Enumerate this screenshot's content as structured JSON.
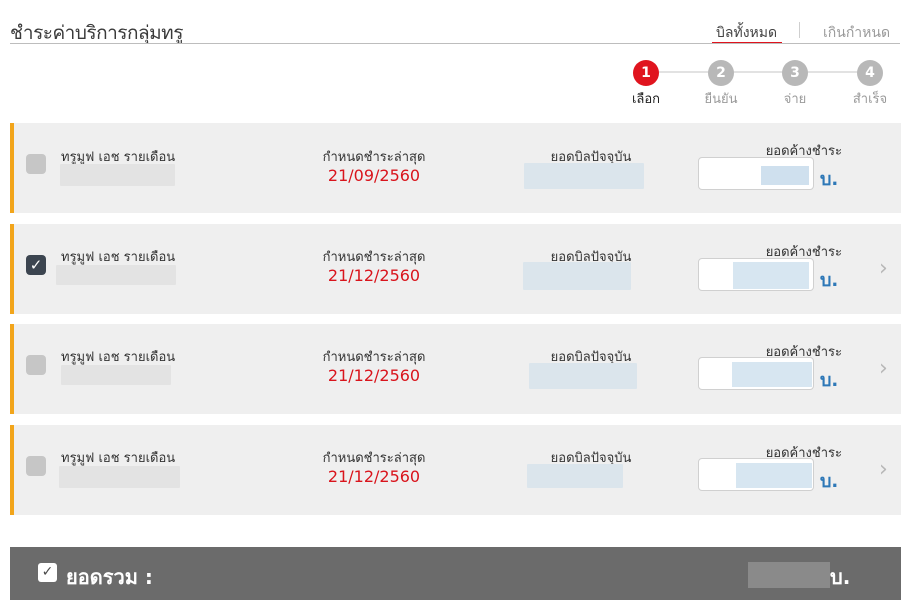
{
  "header": {
    "title": "ชำระค่าบริการกลุ่มทรู",
    "filters": {
      "all": "บิลทั้งหมด",
      "overdue": "เกินกำหนด"
    }
  },
  "steps": [
    {
      "num": "1",
      "label": "เลือก"
    },
    {
      "num": "2",
      "label": "ยืนยัน"
    },
    {
      "num": "3",
      "label": "จ่าย"
    },
    {
      "num": "4",
      "label": "สำเร็จ"
    }
  ],
  "bills": [
    {
      "package": "ทรูมูฟ เอช รายเดือน",
      "due_label": "กำหนดชำระล่าสุด",
      "due_date": "21/09/2560",
      "bill_label": "ยอดบิลปัจจุบัน",
      "owe_label": "ยอดค้างชำระ",
      "currency": "บ.",
      "checked": false
    },
    {
      "package": "ทรูมูฟ เอช รายเดือน",
      "due_label": "กำหนดชำระล่าสุด",
      "due_date": "21/12/2560",
      "bill_label": "ยอดบิลปัจจุบัน",
      "owe_label": "ยอดค้างชำระ",
      "currency": "บ.",
      "checked": true
    },
    {
      "package": "ทรูมูฟ เอช รายเดือน",
      "due_label": "กำหนดชำระล่าสุด",
      "due_date": "21/12/2560",
      "bill_label": "ยอดบิลปัจจุบัน",
      "owe_label": "ยอดค้างชำระ",
      "currency": "บ.",
      "checked": false
    },
    {
      "package": "ทรูมูฟ เอช รายเดือน",
      "due_label": "กำหนดชำระล่าสุด",
      "due_date": "21/12/2560",
      "bill_label": "ยอดบิลปัจจุบัน",
      "owe_label": "ยอดค้างชำระ",
      "currency": "บ.",
      "checked": false
    }
  ],
  "total": {
    "label": "ยอดรวม :",
    "currency": "บ."
  },
  "icons": {
    "check": "check-icon",
    "chevron": "chevron-right-icon"
  },
  "colors": {
    "accent_red": "#e0141e",
    "card_border": "#f2a51b",
    "baht_blue": "#2e78b7",
    "total_bar": "#6b6b6b"
  }
}
